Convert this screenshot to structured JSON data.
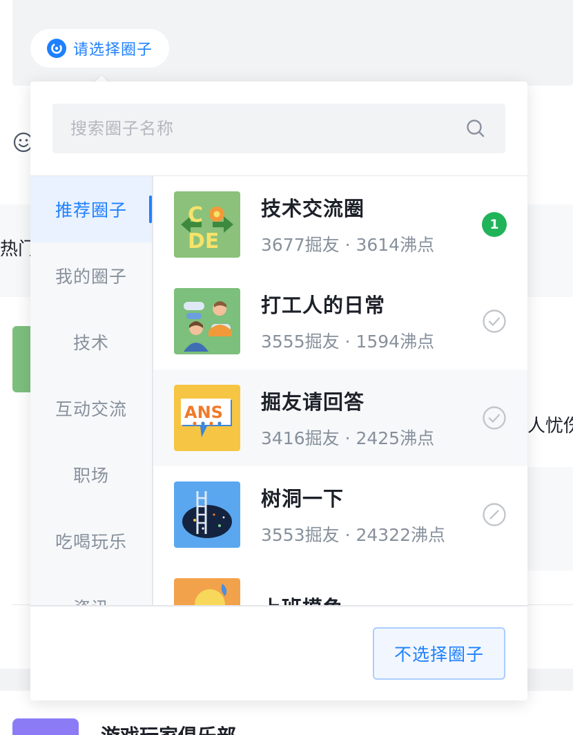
{
  "trigger": {
    "label": "请选择圈子",
    "icon": "circle-refresh-icon"
  },
  "background": {
    "hot_text": "热门",
    "right_text": "人忧伤",
    "bottom_title": "游戏玩家俱乐部"
  },
  "search": {
    "placeholder": "搜索圈子名称",
    "value": ""
  },
  "categories": [
    {
      "label": "推荐圈子",
      "active": true
    },
    {
      "label": "我的圈子"
    },
    {
      "label": "技术"
    },
    {
      "label": "互动交流"
    },
    {
      "label": "职场"
    },
    {
      "label": "吃喝玩乐"
    },
    {
      "label": "资讯"
    }
  ],
  "circles": [
    {
      "name": "技术交流圈",
      "meta": "3677掘友 · 3614沸点",
      "status": "badge",
      "badge": "1",
      "thumb": "code-thumbnail"
    },
    {
      "name": "打工人的日常",
      "meta": "3555掘友 · 1594沸点",
      "status": "check",
      "thumb": "chat-people-thumbnail"
    },
    {
      "name": "掘友请回答",
      "meta": "3416掘友 · 2425沸点",
      "status": "check",
      "thumb": "ans-thumbnail"
    },
    {
      "name": "树洞一下",
      "meta": "3553掘友 · 24322沸点",
      "status": "blocked",
      "thumb": "tree-hole-thumbnail"
    },
    {
      "name": "上班摸鱼",
      "meta": "",
      "status": "none",
      "thumb": "fish-thumbnail"
    }
  ],
  "footer": {
    "no_select_label": "不选择圈子"
  },
  "colors": {
    "accent": "#1e80ff",
    "badge": "#21b35a",
    "muted": "#86909c"
  }
}
